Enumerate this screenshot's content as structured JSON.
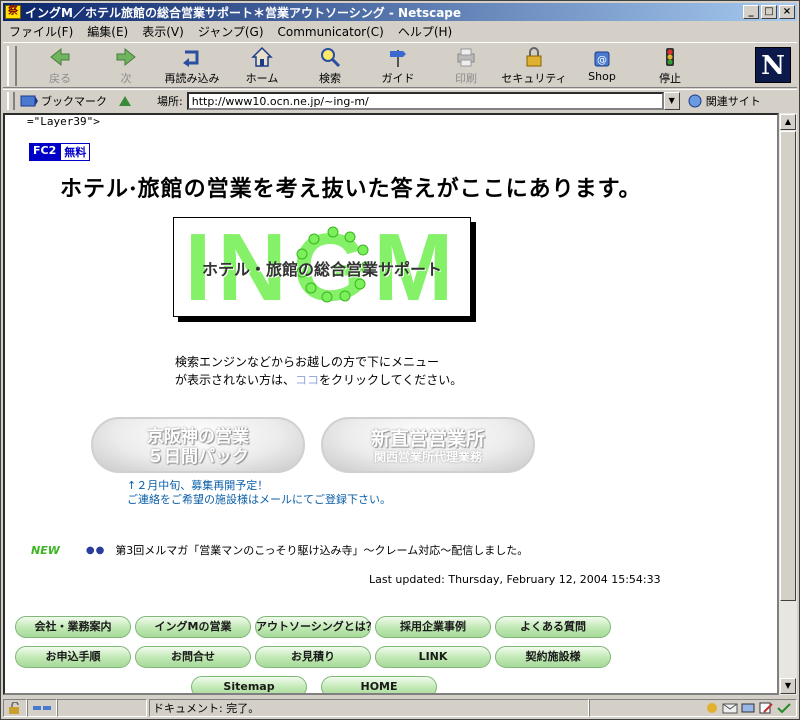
{
  "window": {
    "title": "イングM／ホテル旅館の総合営業サポート＊営業アウトソーシング - Netscape",
    "app_icon_glyph": "祭",
    "minimize_glyph": "_",
    "maximize_glyph": "□",
    "close_glyph": "×"
  },
  "menu": [
    "ファイル(F)",
    "編集(E)",
    "表示(V)",
    "ジャンプ(G)",
    "Communicator(C)",
    "ヘルプ(H)"
  ],
  "toolbar": {
    "back": "戻る",
    "forward": "次",
    "reload": "再読み込み",
    "home": "ホーム",
    "search": "検索",
    "guide": "ガイド",
    "print": "印刷",
    "security": "セキュリティ",
    "shop": "Shop",
    "stop": "停止",
    "logo": "N"
  },
  "location": {
    "bookmarks": "ブックマーク",
    "label": "場所:",
    "url": "http://www10.ocn.ne.jp/~ing-m/",
    "related": "関連サイト"
  },
  "page": {
    "layer_text": "=\"Layer39\">",
    "fc2": "FC2",
    "fc2_free": "無料",
    "headline": "ホテル·旅館の営業を考え抜いた答えがここにあります。",
    "logo_text": "INGM",
    "logo_subtitle": "ホテル・旅館の総合営業サポート",
    "notice_line1": "検索エンジンなどからお越しの方で下にメニュー",
    "notice_line2_pre": "が表示されない方は、",
    "notice_here": "ココ",
    "notice_line2_post": "をクリックしてください。",
    "pack_button_line1": "京阪神の営業",
    "pack_button_line2": "５日間パック",
    "office_button_line1": "新直営営業所",
    "office_button_line2": "関西営業所代理業務",
    "recruit_line1": "↑２月中旬、募集再開予定！",
    "recruit_line2": "ご連絡をご希望の施設様はメールにてご登録下さい。",
    "new_badge": "NEW",
    "news_bullets": "●●",
    "news_text": "第3回メルマガ「営業マンのこっそり駆け込み寺」〜クレーム対応〜配信しました。",
    "last_updated": "Last updated: Thursday, February 12, 2004 15:54:33"
  },
  "nav": {
    "row1": [
      "会社・業務案内",
      "イングMの営業",
      "アウトソーシングとは？",
      "採用企業事例",
      "よくある質問"
    ],
    "row2": [
      "お申込手順",
      "お問合せ",
      "お見積り",
      "LINK",
      "契約施設様"
    ],
    "row3": [
      "Sitemap",
      "HOME"
    ]
  },
  "status": {
    "text": "ドキュメント: 完了。"
  },
  "colors": {
    "title_bar": "#0a246a",
    "logo_green": "#70ef50",
    "nav_green": "#bfe8b2",
    "new_green": "#3cb521",
    "link_blue": "#0a5fa8"
  }
}
